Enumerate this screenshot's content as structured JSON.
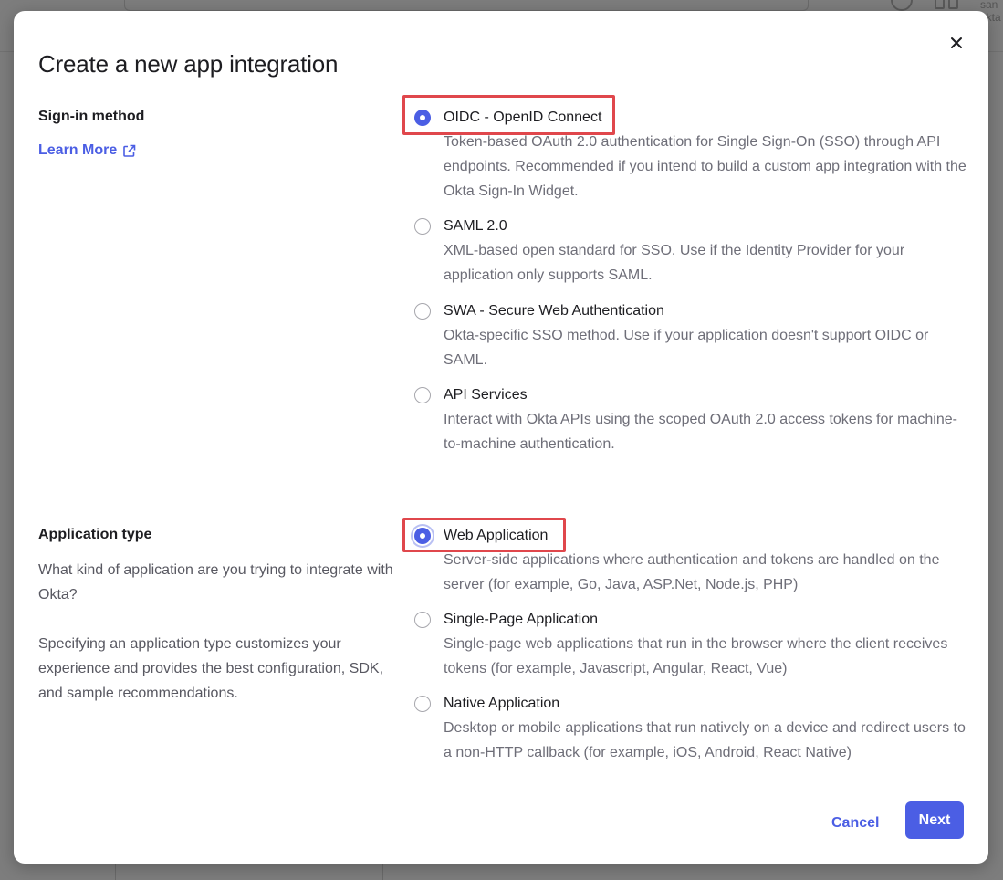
{
  "background": {
    "user_text_line1": "san",
    "user_text_line2": "okta"
  },
  "dialog": {
    "title": "Create a new app integration",
    "close_icon": "close-icon"
  },
  "sign_in": {
    "label": "Sign-in method",
    "learn_more": "Learn More",
    "options": [
      {
        "label": "OIDC - OpenID Connect",
        "desc": "Token-based OAuth 2.0 authentication for Single Sign-On (SSO) through API endpoints. Recommended if you intend to build a custom app integration with the Okta Sign-In Widget.",
        "selected": true
      },
      {
        "label": "SAML 2.0",
        "desc": "XML-based open standard for SSO. Use if the Identity Provider for your application only supports SAML.",
        "selected": false
      },
      {
        "label": "SWA - Secure Web Authentication",
        "desc": "Okta-specific SSO method. Use if your application doesn't support OIDC or SAML.",
        "selected": false
      },
      {
        "label": "API Services",
        "desc": "Interact with Okta APIs using the scoped OAuth 2.0 access tokens for machine-to-machine authentication.",
        "selected": false
      }
    ]
  },
  "app_type": {
    "label": "Application type",
    "desc1": "What kind of application are you trying to integrate with Okta?",
    "desc2": "Specifying an application type customizes your experience and provides the best configuration, SDK, and sample recommendations.",
    "options": [
      {
        "label": "Web Application",
        "desc": "Server-side applications where authentication and tokens are handled on the server (for example, Go, Java, ASP.Net, Node.js, PHP)",
        "selected": true
      },
      {
        "label": "Single-Page Application",
        "desc": "Single-page web applications that run in the browser where the client receives tokens (for example, Javascript, Angular, React, Vue)",
        "selected": false
      },
      {
        "label": "Native Application",
        "desc": "Desktop or mobile applications that run natively on a device and redirect users to a non-HTTP callback (for example, iOS, Android, React Native)",
        "selected": false
      }
    ]
  },
  "footer": {
    "cancel": "Cancel",
    "next": "Next"
  },
  "colors": {
    "accent": "#4b5ee4",
    "highlight": "#e0474c"
  }
}
